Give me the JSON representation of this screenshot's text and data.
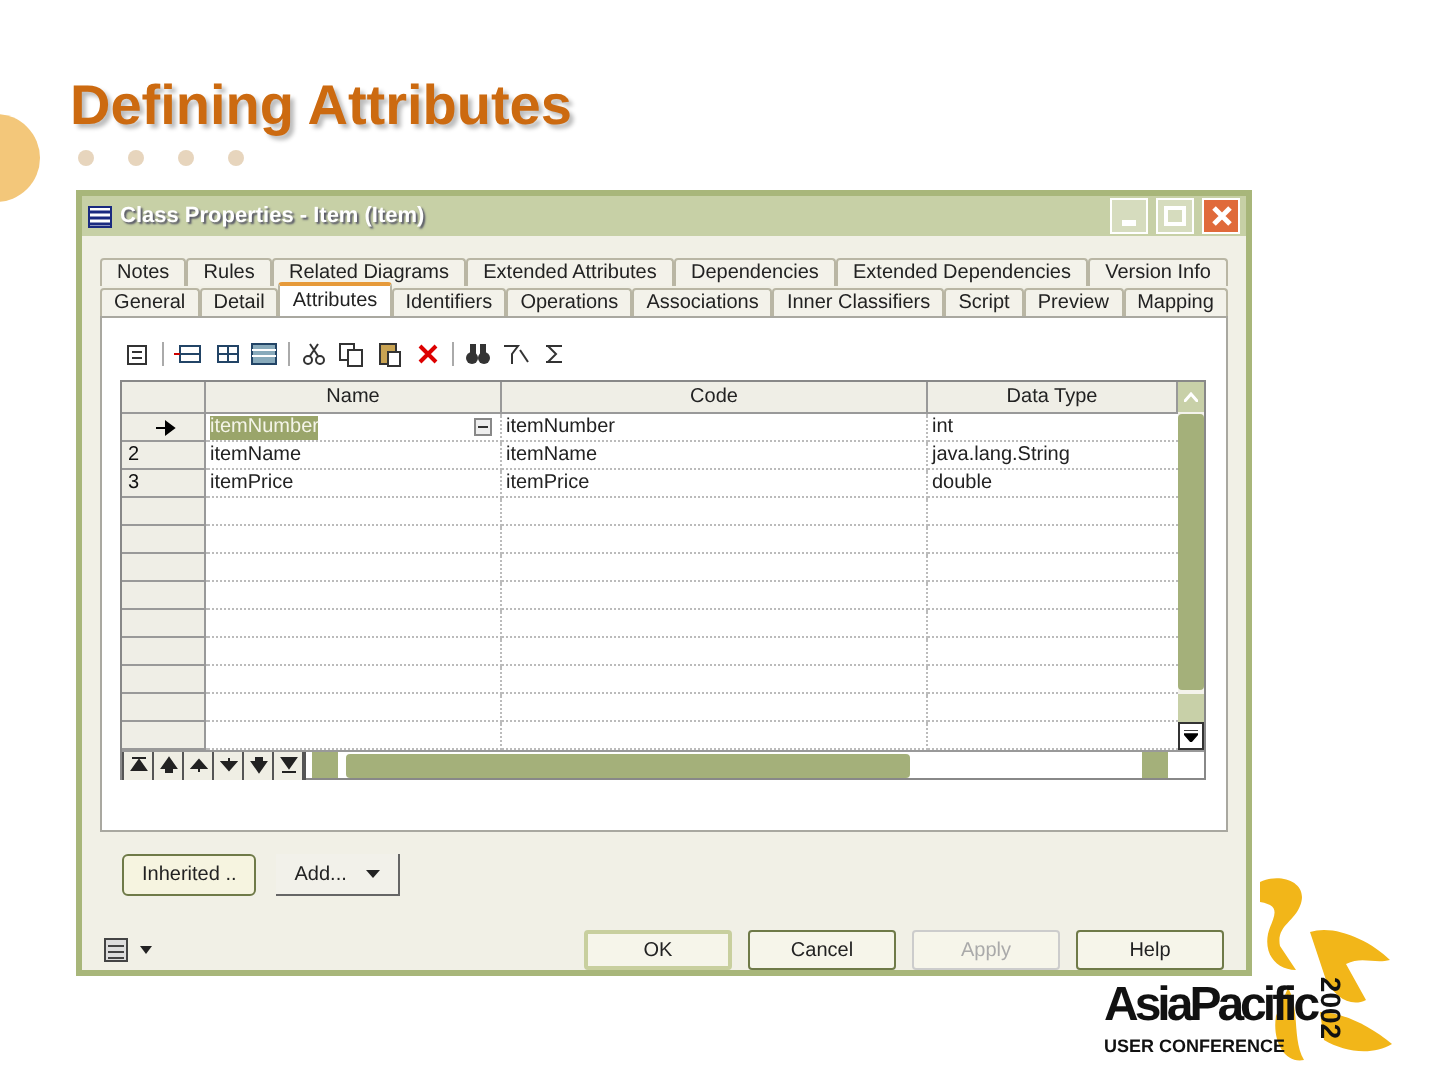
{
  "slide": {
    "title": "Defining Attributes"
  },
  "window": {
    "title": "Class Properties - Item (Item)"
  },
  "tab_rows": [
    {
      "tabs": [
        {
          "label": "Notes",
          "selected": false
        },
        {
          "label": "Rules",
          "selected": false
        },
        {
          "label": "Related Diagrams",
          "selected": false
        },
        {
          "label": "Extended Attributes",
          "selected": false
        },
        {
          "label": "Dependencies",
          "selected": false
        },
        {
          "label": "Extended Dependencies",
          "selected": false
        },
        {
          "label": "Version Info",
          "selected": false
        }
      ]
    },
    {
      "tabs": [
        {
          "label": "General",
          "selected": false
        },
        {
          "label": "Detail",
          "selected": false
        },
        {
          "label": "Attributes",
          "selected": true
        },
        {
          "label": "Identifiers",
          "selected": false
        },
        {
          "label": "Operations",
          "selected": false
        },
        {
          "label": "Associations",
          "selected": false
        },
        {
          "label": "Inner Classifiers",
          "selected": false
        },
        {
          "label": "Script",
          "selected": false
        },
        {
          "label": "Preview",
          "selected": false
        },
        {
          "label": "Mapping",
          "selected": false
        }
      ]
    }
  ],
  "table": {
    "columns": [
      "Name",
      "Code",
      "Data Type"
    ],
    "rows": [
      {
        "current": true,
        "name": "itemNumber",
        "code": "itemNumber",
        "data_type": "int"
      },
      {
        "current": false,
        "number": "2",
        "name": "itemName",
        "code": "itemName",
        "data_type": "java.lang.String"
      },
      {
        "current": false,
        "number": "3",
        "name": "itemPrice",
        "code": "itemPrice",
        "data_type": "double"
      }
    ]
  },
  "panel_buttons": [
    {
      "label": "Inherited ..",
      "kind": "plain"
    },
    {
      "label": "Add...",
      "kind": "dropdown"
    }
  ],
  "dialog_buttons": [
    {
      "label": "OK",
      "disabled": false,
      "default": true
    },
    {
      "label": "Cancel",
      "disabled": false,
      "default": false
    },
    {
      "label": "Apply",
      "disabled": true,
      "default": false
    },
    {
      "label": "Help",
      "disabled": false,
      "default": false
    }
  ],
  "logo": {
    "name": "AsiaPacific",
    "year": "2002",
    "subtitle": "USER CONFERENCE"
  }
}
